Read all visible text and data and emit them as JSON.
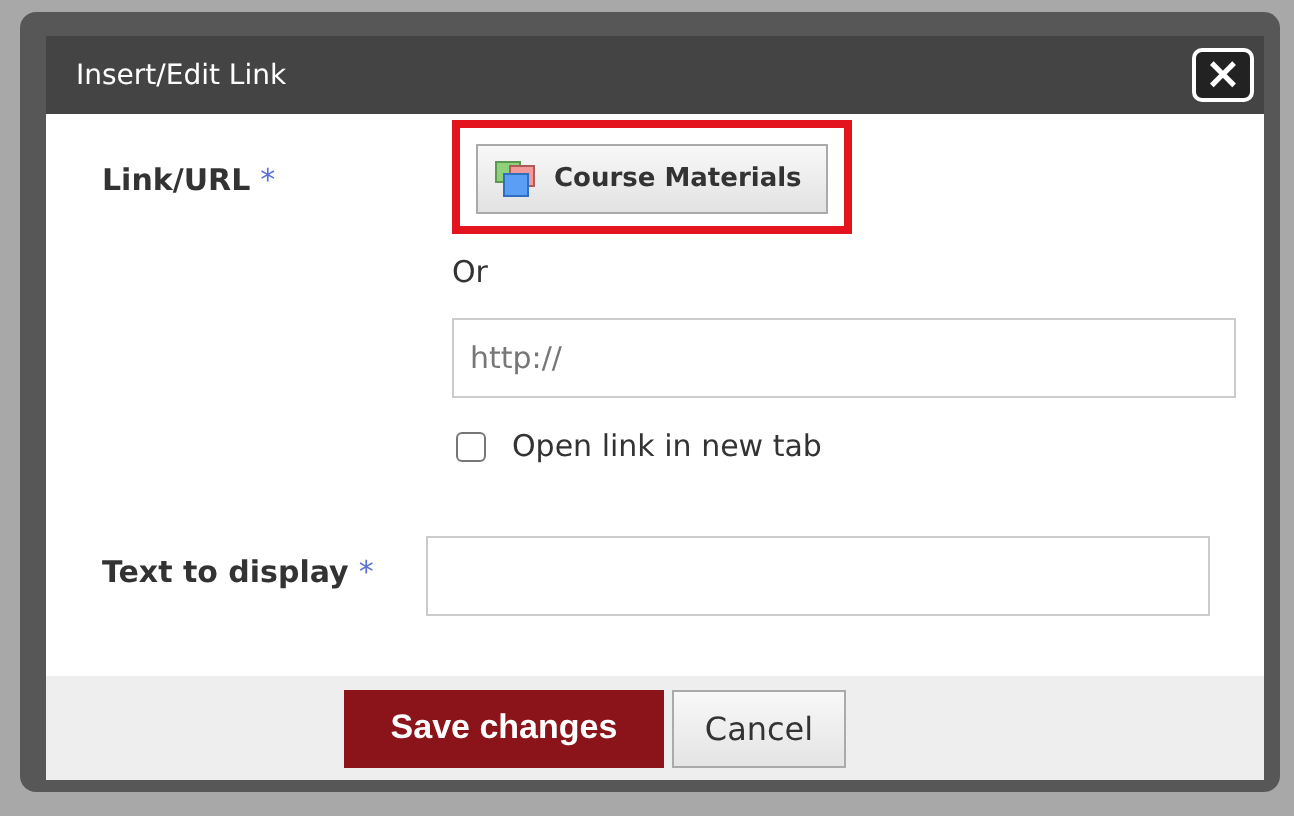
{
  "dialog": {
    "title": "Insert/Edit Link",
    "close": "×",
    "link_url": {
      "label": "Link/URL",
      "required": "*",
      "button": "Course Materials"
    },
    "or": "Or",
    "url_field": {
      "placeholder": "http://"
    },
    "new_tab": {
      "label": "Open link in new tab",
      "checked": false
    },
    "text_to_display": {
      "label": "Text to display",
      "required": "*"
    },
    "buttons": [
      {
        "label": "Save changes",
        "kind": "primary"
      },
      {
        "label": "Cancel",
        "kind": "secondary"
      }
    ]
  }
}
